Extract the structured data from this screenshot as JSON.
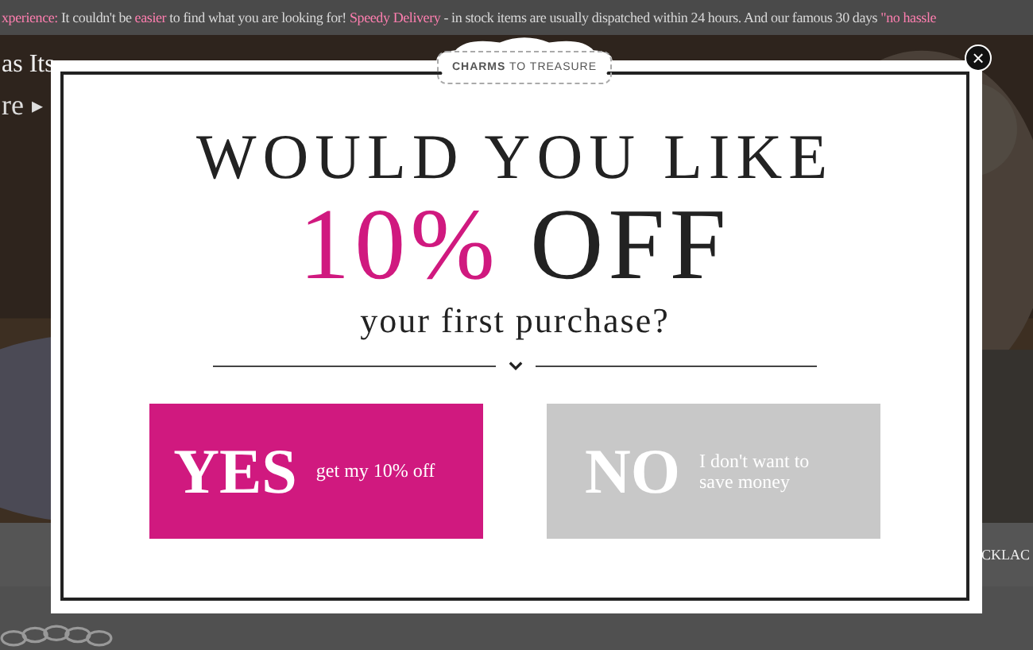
{
  "banner": [
    {
      "text": "xperience:",
      "highlight": true
    },
    {
      "text": "It couldn't be",
      "highlight": false
    },
    {
      "text": "easier",
      "highlight": true
    },
    {
      "text": "to find what you are looking for!",
      "highlight": false
    },
    {
      "text": "Speedy Delivery",
      "highlight": true
    },
    {
      "text": "- in stock items are usually dispatched within 24 hours. And our famous 30 days",
      "highlight": false
    },
    {
      "text": "\"no hassle",
      "highlight": true
    }
  ],
  "hero": {
    "kind": "picture",
    "title": "as Its",
    "link": "re",
    "arrow": "▸"
  },
  "nav": {
    "item": "CKLAC"
  },
  "popup": {
    "logo": {
      "bold": "CHARMS",
      "rest": "TO TREASURE"
    },
    "close": "×",
    "headline": "WOULD YOU LIKE",
    "offer": {
      "highlight": "10%",
      "rest": "OFF"
    },
    "subtitle": "your first purchase?",
    "buttons": [
      {
        "kind": "accept",
        "word": "YES",
        "caption": "get my 10% off"
      },
      {
        "kind": "decline",
        "word": "NO",
        "caption": "I don't want to save money"
      }
    ]
  }
}
